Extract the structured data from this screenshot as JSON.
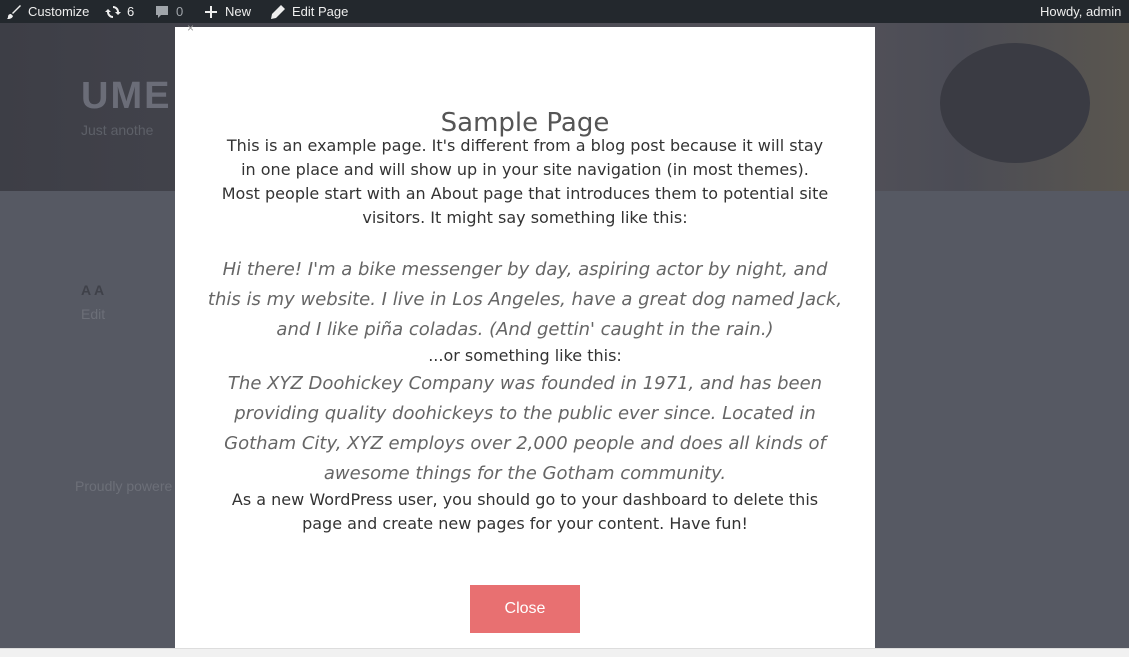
{
  "adminbar": {
    "customize_label": "Customize",
    "updates_count": "6",
    "comments_count": "0",
    "new_label": "New",
    "edit_page_label": "Edit Page",
    "greeting": "Howdy, admin"
  },
  "background": {
    "site_title": "UME",
    "site_tagline": "Just anothe",
    "aa": "A A",
    "edit_link": "Edit",
    "footer_text": "Proudly powere"
  },
  "modal": {
    "close_x": "×",
    "title": "Sample Page",
    "intro": "This is an example page. It's different from a blog post because it will stay in one place and will show up in your site navigation (in most themes). Most people start with an About page that introduces them to potential site visitors. It might say something like this:",
    "quote1": "Hi there! I'm a bike messenger by day, aspiring actor by night, and this is my website. I live in Los Angeles, have a great dog named Jack, and I like piña coladas. (And gettin' caught in the rain.)",
    "or_text": "...or something like this:",
    "quote2": "The XYZ Doohickey Company was founded in 1971, and has been providing quality doohickeys to the public ever since. Located in Gotham City, XYZ employs over 2,000 people and does all kinds of awesome things for the Gotham community.",
    "outro": "As a new WordPress user, you should go to your dashboard to delete this page and create new pages for your content. Have fun!",
    "close_button": "Close"
  }
}
